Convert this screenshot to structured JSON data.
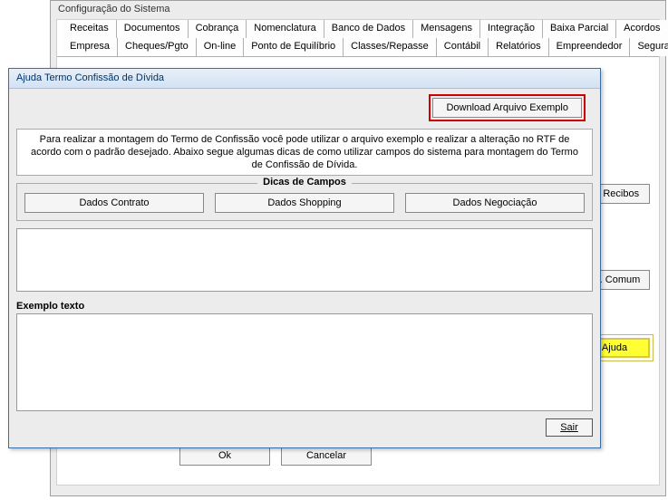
{
  "parent": {
    "title": "Configuração do Sistema",
    "tabs_row1": [
      "Receitas",
      "Documentos",
      "Cobrança",
      "Nomenclatura",
      "Banco de Dados",
      "Mensagens",
      "Integração",
      "Baixa Parcial",
      "Acordos"
    ],
    "tabs_row2": [
      "Empresa",
      "Cheques/Pgto",
      "On-line",
      "Ponto de Equilíbrio",
      "Classes/Repasse",
      "Contábil",
      "Relatórios",
      "Empreendedor",
      "Segurança"
    ],
    "side": {
      "aba": "aba Recibos",
      "comum": "Enc. Comum",
      "ajuda": "Ajuda"
    },
    "bottom": {
      "ok": "Ok",
      "cancel": "Cancelar"
    }
  },
  "dialog": {
    "title": "Ajuda Termo Confissão de Dívida",
    "download": "Download Arquivo Exemplo",
    "info": "Para realizar a montagem do Termo de Confissão você pode utilizar o arquivo exemplo e realizar a alteração no RTF de acordo com o padrão desejado. Abaixo segue algumas dicas de como utilizar campos do sistema para montagem do Termo de Confissão de Dívida.",
    "fieldset_title": "Dicas de Campos",
    "btns": {
      "contrato": "Dados Contrato",
      "shopping": "Dados Shopping",
      "negociacao": "Dados Negociação"
    },
    "example_label": "Exemplo texto",
    "sair": "Sair"
  }
}
